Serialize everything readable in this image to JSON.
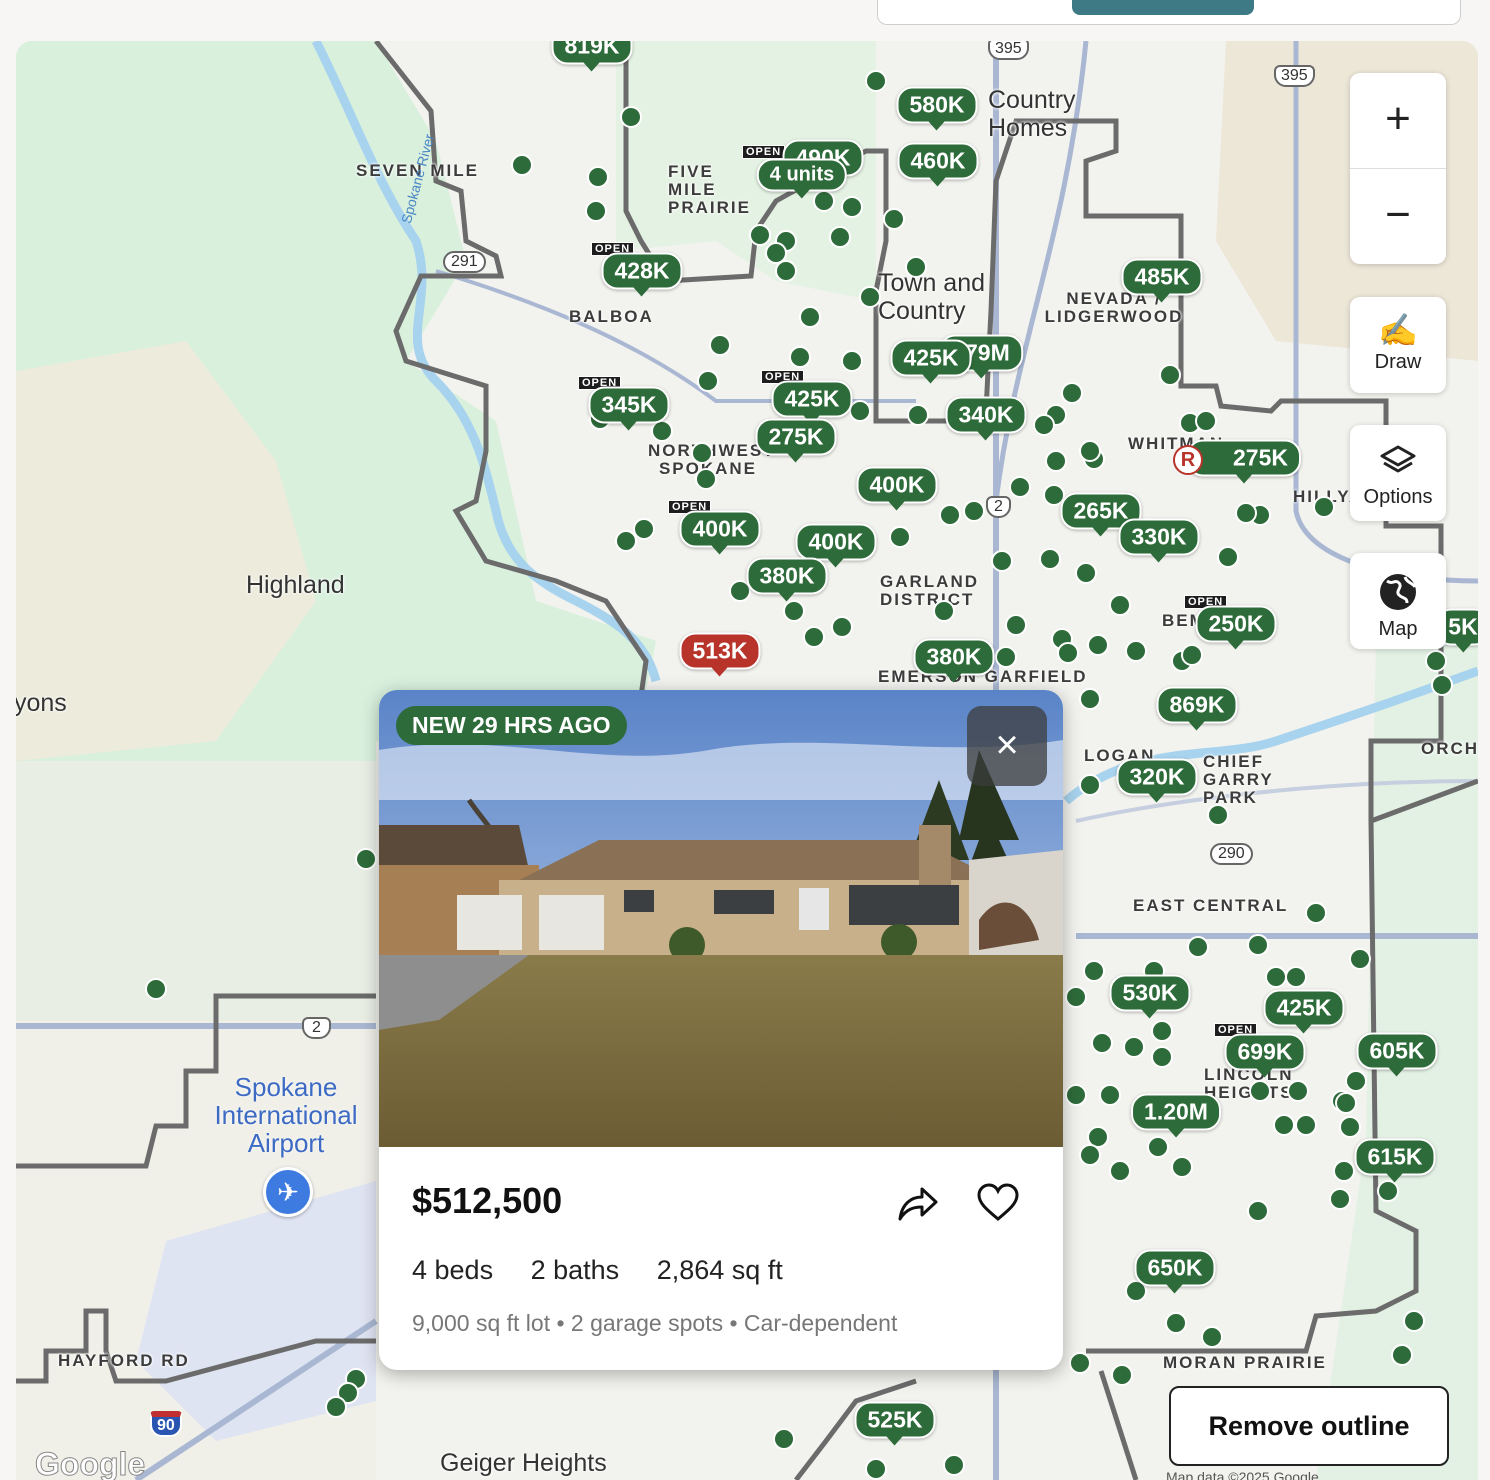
{
  "map": {
    "place_labels": [
      {
        "text": "SEVEN MILE"
      },
      {
        "text": "FIVE MILE PRAIRIE"
      },
      {
        "text": "BALBOA"
      },
      {
        "text": "NEVADA / LIDGERWOOD"
      },
      {
        "text": "NORTHWEST SPOKANE"
      },
      {
        "text": "WHITMAN"
      },
      {
        "text": "GARLAND DISTRICT"
      },
      {
        "text": "CHIEF GARRY PARK"
      },
      {
        "text": "EAST CENTRAL"
      },
      {
        "text": "LINCOLN HEIGHTS"
      },
      {
        "text": "MORAN PRAIRIE"
      },
      {
        "text": "HAYFORD RD"
      },
      {
        "text": "ORCHARD"
      },
      {
        "text": "HILLYARD"
      },
      {
        "text": "EMERSON GARFIELD"
      },
      {
        "text": "LOGAN"
      },
      {
        "text": "BEMISS"
      }
    ],
    "large_labels": [
      {
        "text": "Highland"
      },
      {
        "text": "yons"
      },
      {
        "text": "Country Homes"
      },
      {
        "text": "Town and Country"
      },
      {
        "text": "Geiger Heights"
      }
    ],
    "airport_label": "Spokane International Airport",
    "river_label": "Spokane River",
    "road_shields": [
      "395",
      "395",
      "291",
      "2",
      "2",
      "290",
      "90",
      "2"
    ],
    "price_pins": [
      {
        "label": "819K",
        "color": "green"
      },
      {
        "label": "580K",
        "color": "green"
      },
      {
        "label": "490K",
        "color": "green"
      },
      {
        "label": "460K",
        "color": "green"
      },
      {
        "label": "4 units",
        "color": "green"
      },
      {
        "label": "428K",
        "color": "green"
      },
      {
        "label": "485K",
        "color": "green"
      },
      {
        "label": "425K",
        "color": "green"
      },
      {
        "label": "379M",
        "color": "green"
      },
      {
        "label": "345K",
        "color": "green"
      },
      {
        "label": "425K",
        "color": "green"
      },
      {
        "label": "340K",
        "color": "green"
      },
      {
        "label": "275K",
        "color": "green"
      },
      {
        "label": "275K",
        "color": "green"
      },
      {
        "label": "400K",
        "color": "green"
      },
      {
        "label": "265K",
        "color": "green"
      },
      {
        "label": "330K",
        "color": "green"
      },
      {
        "label": "400K",
        "color": "green"
      },
      {
        "label": "400K",
        "color": "green"
      },
      {
        "label": "380K",
        "color": "green"
      },
      {
        "label": "250K",
        "color": "green"
      },
      {
        "label": "513K",
        "color": "red"
      },
      {
        "label": "380K",
        "color": "green"
      },
      {
        "label": "869K",
        "color": "green"
      },
      {
        "label": "320K",
        "color": "green"
      },
      {
        "label": "530K",
        "color": "green"
      },
      {
        "label": "425K",
        "color": "green"
      },
      {
        "label": "699K",
        "color": "green"
      },
      {
        "label": "605K",
        "color": "green"
      },
      {
        "label": "1.20M",
        "color": "green"
      },
      {
        "label": "615K",
        "color": "green"
      },
      {
        "label": "650K",
        "color": "green"
      },
      {
        "label": "525K",
        "color": "green"
      },
      {
        "label": "5K",
        "color": "green"
      }
    ],
    "open_tag": "OPEN",
    "rental_badge": "R",
    "attribution": "Map data ©2025 Google",
    "google_logo": "Google"
  },
  "controls": {
    "zoom_in": "+",
    "zoom_out": "−",
    "draw_label": "Draw",
    "options_label": "Options",
    "map_label": "Map",
    "remove_outline": "Remove outline"
  },
  "listing_card": {
    "badge": "NEW 29 HRS AGO",
    "price": "$512,500",
    "beds": "4 beds",
    "baths": "2 baths",
    "sqft": "2,864 sq ft",
    "details": "9,000 sq ft lot • 2 garage spots • Car-dependent",
    "close": "×"
  }
}
